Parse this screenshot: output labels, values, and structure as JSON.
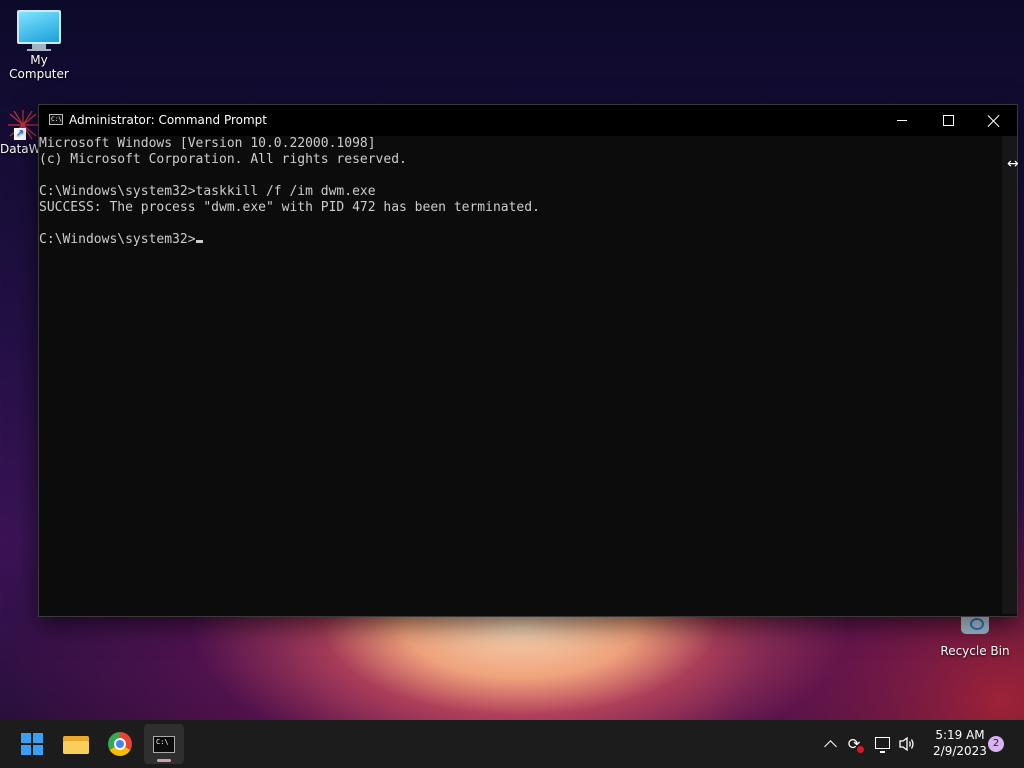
{
  "desktop": {
    "icons": [
      {
        "label": "My Computer",
        "icon": "monitor-icon"
      },
      {
        "label": "DataW",
        "icon": "dataw-shortcut-icon"
      },
      {
        "label": "Recycle Bin",
        "icon": "recycle-bin-icon"
      }
    ]
  },
  "window": {
    "title": "Administrator: Command Prompt",
    "icon_text": "C:\\",
    "console_lines": [
      "Microsoft Windows [Version 10.0.22000.1098]",
      "(c) Microsoft Corporation. All rights reserved.",
      "",
      "C:\\Windows\\system32>taskkill /f /im dwm.exe",
      "SUCCESS: The process \"dwm.exe\" with PID 472 has been terminated.",
      "",
      "C:\\Windows\\system32>"
    ],
    "controls": {
      "minimize": "minimize-icon",
      "maximize": "maximize-icon",
      "close": "close-icon"
    },
    "background_color": "#0c0c0c",
    "text_color": "#cccccc"
  },
  "taskbar": {
    "apps": [
      {
        "name": "Start",
        "icon": "windows-start-icon"
      },
      {
        "name": "File Explorer",
        "icon": "file-explorer-icon"
      },
      {
        "name": "Google Chrome",
        "icon": "chrome-icon"
      },
      {
        "name": "Command Prompt",
        "icon": "command-prompt-icon",
        "active": true
      }
    ],
    "cmd_icon_text": "C:\\",
    "tray": {
      "icons": [
        "chevron-up-icon",
        "sync-icon",
        "network-icon",
        "volume-icon"
      ],
      "time": "5:19 AM",
      "date": "2/9/2023",
      "notification_count": "2"
    },
    "accent_color": "#3aa0f3"
  }
}
